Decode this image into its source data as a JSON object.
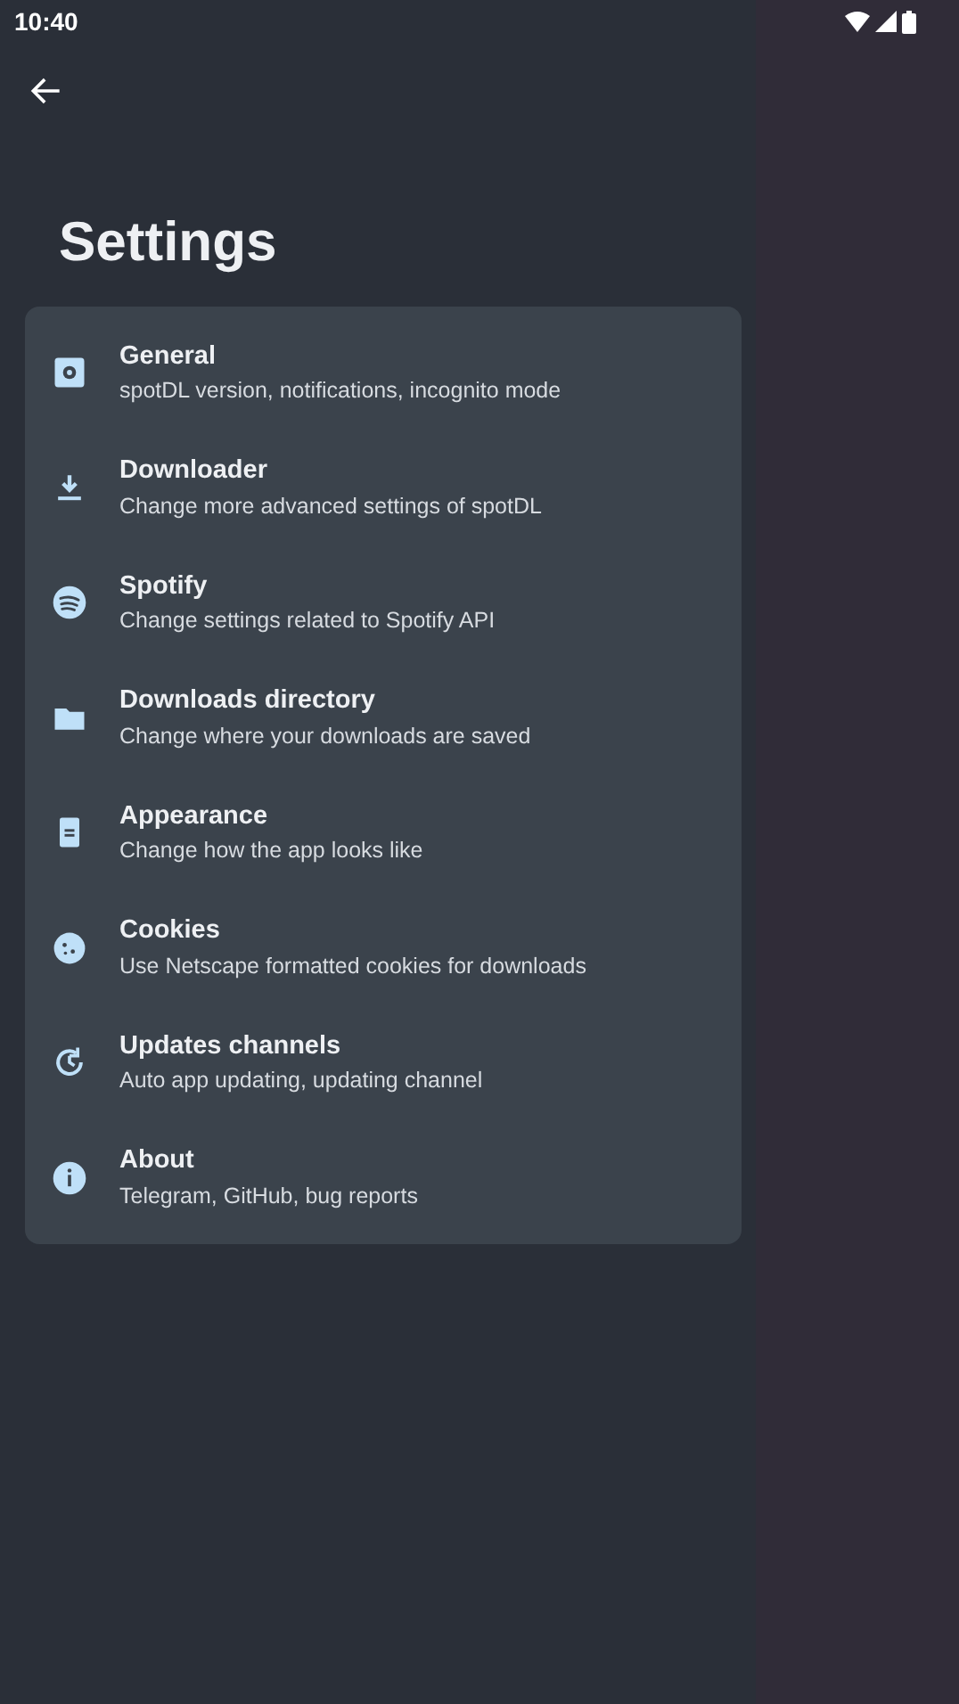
{
  "status_bar": {
    "time": "10:40"
  },
  "title": "Settings",
  "items": [
    {
      "title": "General",
      "subtitle": "spotDL version, notifications, incognito mode"
    },
    {
      "title": "Downloader",
      "subtitle": "Change more advanced settings of spotDL"
    },
    {
      "title": "Spotify",
      "subtitle": "Change settings related to Spotify API"
    },
    {
      "title": "Downloads directory",
      "subtitle": "Change where your downloads are saved"
    },
    {
      "title": "Appearance",
      "subtitle": "Change how the app looks like"
    },
    {
      "title": "Cookies",
      "subtitle": "Use Netscape formatted cookies for downloads"
    },
    {
      "title": "Updates channels",
      "subtitle": "Auto app updating, updating channel"
    },
    {
      "title": "About",
      "subtitle": "Telegram, GitHub, bug reports"
    }
  ]
}
